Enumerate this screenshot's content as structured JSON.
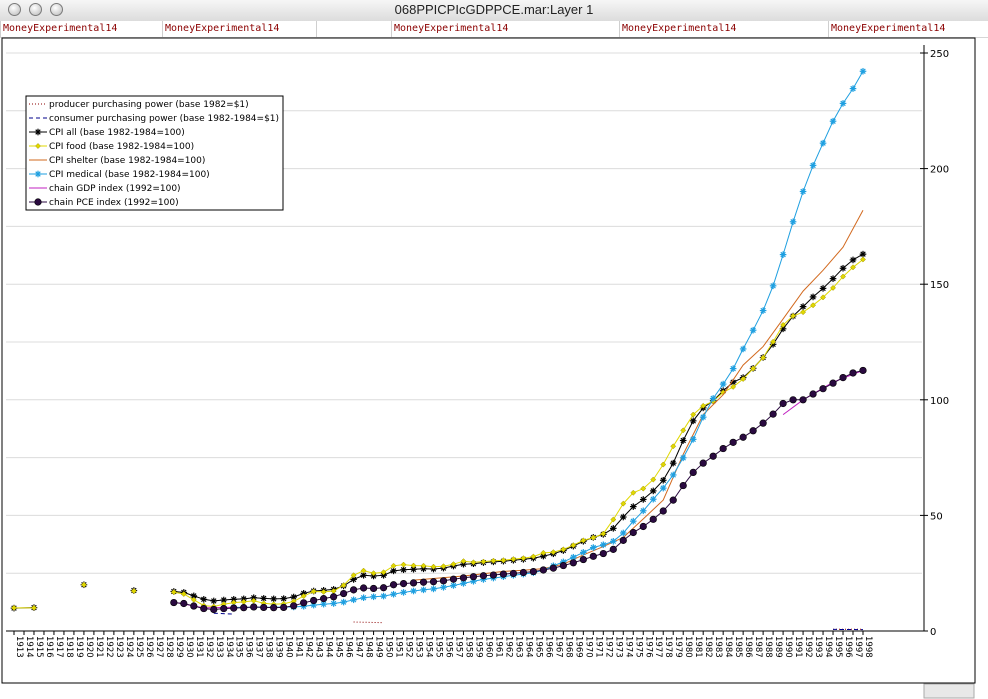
{
  "window": {
    "title": "068PPICPIcGDPPCE.mar:Layer 1"
  },
  "top_tabs": [
    "MoneyExperimental14",
    "MoneyExperimental14",
    "MoneyExperimental14",
    "MoneyExperimental14",
    "MoneyExperimental14"
  ],
  "chart_data": {
    "type": "line",
    "title": "",
    "xlabel": "",
    "ylabel": "",
    "ylim": [
      0,
      250
    ],
    "yticks": [
      0,
      50,
      100,
      150,
      200,
      250
    ],
    "x_range": [
      1913,
      1998
    ],
    "grid": "horizontal",
    "legend_position": "top-left",
    "series": [
      {
        "name": "producer purchasing power (base 1982=$1)",
        "color": "#8b0000",
        "style": "dotted",
        "x": [
          1947,
          1950,
          1955,
          1960,
          1965,
          1970,
          1975,
          1980,
          1985,
          1990,
          1995,
          1998
        ],
        "values": [
          3.9,
          3.6,
          3.4,
          3.1,
          3.0,
          2.7,
          2.0,
          1.4,
          1.0,
          0.9,
          0.8,
          0.8
        ]
      },
      {
        "name": "consumer purchasing power (base 1982-1984=$1)",
        "color": "#00008b",
        "style": "dashed",
        "x": [
          1929,
          1933,
          1935,
          1940,
          1945,
          1950,
          1955,
          1960,
          1965,
          1970,
          1975,
          1980,
          1985,
          1990,
          1995,
          1998
        ],
        "values": [
          5.8,
          7.7,
          7.3,
          7.2,
          5.6,
          4.2,
          3.7,
          3.4,
          3.2,
          2.6,
          1.9,
          1.2,
          0.9,
          0.8,
          0.7,
          0.6
        ]
      },
      {
        "name": "CPI all (base 1982-1984=100)",
        "color": "#000000",
        "marker": "asterisk",
        "x": [
          1913,
          1915,
          1920,
          1925,
          1929,
          1930,
          1931,
          1932,
          1933,
          1934,
          1935,
          1936,
          1937,
          1938,
          1939,
          1940,
          1941,
          1942,
          1943,
          1944,
          1945,
          1946,
          1947,
          1948,
          1949,
          1950,
          1951,
          1952,
          1953,
          1954,
          1955,
          1956,
          1957,
          1958,
          1959,
          1960,
          1961,
          1962,
          1963,
          1964,
          1965,
          1966,
          1967,
          1968,
          1969,
          1970,
          1971,
          1972,
          1973,
          1974,
          1975,
          1976,
          1977,
          1978,
          1979,
          1980,
          1981,
          1982,
          1983,
          1984,
          1985,
          1986,
          1987,
          1988,
          1989,
          1990,
          1991,
          1992,
          1993,
          1994,
          1995,
          1996,
          1997,
          1998
        ],
        "values": [
          9.9,
          10.1,
          20.0,
          17.5,
          17.1,
          16.7,
          15.2,
          13.7,
          13.0,
          13.4,
          13.7,
          13.9,
          14.4,
          14.1,
          13.9,
          14.0,
          14.7,
          16.3,
          17.3,
          17.6,
          18.0,
          19.5,
          22.3,
          24.1,
          23.8,
          24.1,
          26.0,
          26.5,
          26.7,
          26.9,
          26.8,
          27.2,
          28.1,
          28.9,
          29.1,
          29.6,
          29.9,
          30.2,
          30.6,
          31.0,
          31.5,
          32.4,
          33.4,
          34.8,
          36.7,
          38.8,
          40.5,
          41.8,
          44.4,
          49.3,
          53.8,
          56.9,
          60.6,
          65.2,
          72.6,
          82.4,
          90.9,
          96.5,
          99.6,
          103.9,
          107.6,
          109.6,
          113.6,
          118.3,
          124.0,
          130.7,
          136.2,
          140.3,
          144.5,
          148.2,
          152.4,
          156.9,
          160.5,
          163.0
        ]
      },
      {
        "name": "CPI food (base 1982-1984=100)",
        "color": "#e0d800",
        "marker": "diamond",
        "x": [
          1913,
          1915,
          1920,
          1925,
          1929,
          1930,
          1931,
          1932,
          1933,
          1934,
          1935,
          1936,
          1937,
          1938,
          1939,
          1940,
          1941,
          1942,
          1943,
          1944,
          1945,
          1946,
          1947,
          1948,
          1949,
          1950,
          1951,
          1952,
          1953,
          1954,
          1955,
          1956,
          1957,
          1958,
          1959,
          1960,
          1961,
          1962,
          1963,
          1964,
          1965,
          1966,
          1967,
          1968,
          1969,
          1970,
          1971,
          1972,
          1973,
          1974,
          1975,
          1976,
          1977,
          1978,
          1979,
          1980,
          1981,
          1982,
          1983,
          1984,
          1985,
          1986,
          1987,
          1988,
          1989,
          1990,
          1991,
          1992,
          1993,
          1994,
          1995,
          1996,
          1997,
          1998
        ],
        "values": [
          10.0,
          10.0,
          20.0,
          17.3,
          16.8,
          16.0,
          13.5,
          11.0,
          10.6,
          11.6,
          12.3,
          12.6,
          13.1,
          12.0,
          11.6,
          11.8,
          12.8,
          15.1,
          17.1,
          16.9,
          17.3,
          19.8,
          24.1,
          26.1,
          25.0,
          25.4,
          28.2,
          28.7,
          28.3,
          28.2,
          27.8,
          28.0,
          28.9,
          30.2,
          29.7,
          30.0,
          30.4,
          30.6,
          31.1,
          31.5,
          32.2,
          33.8,
          34.1,
          35.3,
          37.1,
          39.2,
          40.4,
          42.1,
          48.2,
          55.1,
          59.8,
          61.6,
          65.5,
          72.0,
          79.9,
          86.8,
          93.6,
          97.4,
          99.4,
          103.2,
          105.6,
          109.0,
          113.5,
          118.2,
          125.1,
          132.4,
          136.3,
          137.9,
          140.9,
          144.3,
          148.4,
          153.3,
          157.3,
          160.7
        ]
      },
      {
        "name": "CPI shelter (base 1982-1984=100)",
        "color": "#d2691e",
        "style": "solid",
        "x": [
          1953,
          1955,
          1958,
          1960,
          1962,
          1964,
          1966,
          1968,
          1970,
          1972,
          1974,
          1976,
          1978,
          1980,
          1982,
          1984,
          1986,
          1988,
          1990,
          1992,
          1994,
          1996,
          1998
        ],
        "values": [
          22.0,
          22.7,
          23.8,
          24.8,
          25.8,
          26.3,
          27.0,
          28.9,
          32.9,
          36.5,
          40.5,
          48.5,
          56.6,
          76.4,
          93.6,
          102.2,
          115.0,
          123.0,
          135.0,
          147.0,
          156.0,
          166.0,
          182.0
        ]
      },
      {
        "name": "CPI medical (base 1982-1984=100)",
        "color": "#1e9fe0",
        "marker": "asterisk",
        "x": [
          1935,
          1936,
          1937,
          1938,
          1939,
          1940,
          1941,
          1942,
          1943,
          1944,
          1945,
          1946,
          1947,
          1948,
          1949,
          1950,
          1951,
          1952,
          1953,
          1954,
          1955,
          1956,
          1957,
          1958,
          1959,
          1960,
          1961,
          1962,
          1963,
          1964,
          1965,
          1966,
          1967,
          1968,
          1969,
          1970,
          1971,
          1972,
          1973,
          1974,
          1975,
          1976,
          1977,
          1978,
          1979,
          1980,
          1981,
          1982,
          1983,
          1984,
          1985,
          1986,
          1987,
          1988,
          1989,
          1990,
          1991,
          1992,
          1993,
          1994,
          1995,
          1996,
          1997,
          1998
        ],
        "values": [
          10.2,
          10.2,
          10.3,
          10.3,
          10.3,
          10.4,
          10.4,
          10.7,
          11.2,
          11.6,
          11.9,
          12.5,
          13.5,
          14.4,
          14.8,
          15.1,
          15.9,
          16.7,
          17.3,
          17.8,
          18.2,
          18.9,
          19.7,
          20.6,
          21.5,
          22.3,
          22.9,
          23.5,
          24.1,
          24.6,
          25.2,
          26.3,
          28.2,
          29.9,
          31.9,
          34.0,
          36.1,
          37.3,
          38.8,
          42.4,
          47.5,
          52.0,
          57.0,
          61.8,
          67.5,
          74.9,
          82.9,
          92.5,
          100.6,
          106.8,
          113.5,
          122.0,
          130.1,
          138.6,
          149.3,
          162.8,
          177.0,
          190.1,
          201.4,
          211.0,
          220.5,
          228.2,
          234.6,
          242.1
        ]
      },
      {
        "name": "chain GDP index (1992=100)",
        "color": "#c020c0",
        "style": "solid",
        "x": [
          1929,
          1932,
          1935,
          1940,
          1945,
          1950,
          1955,
          1960,
          1965,
          1970,
          1975,
          1980,
          1985,
          1990,
          1992,
          1995,
          1998
        ],
        "values": [
          12.5,
          10.0,
          10.3,
          11.0,
          16.5,
          20.8,
          23.5,
          26.5,
          28.4,
          35.0,
          49.2,
          67.5,
          80.5,
          93.6,
          100.0,
          107.6,
          112.7
        ]
      },
      {
        "name": "chain PCE index (1992=100)",
        "color": "#2a0a40",
        "marker": "circle",
        "x": [
          1929,
          1930,
          1931,
          1932,
          1933,
          1934,
          1935,
          1936,
          1937,
          1938,
          1939,
          1940,
          1941,
          1942,
          1943,
          1944,
          1945,
          1946,
          1947,
          1948,
          1949,
          1950,
          1951,
          1952,
          1953,
          1954,
          1955,
          1956,
          1957,
          1958,
          1959,
          1960,
          1961,
          1962,
          1963,
          1964,
          1965,
          1966,
          1967,
          1968,
          1969,
          1970,
          1971,
          1972,
          1973,
          1974,
          1975,
          1976,
          1977,
          1978,
          1979,
          1980,
          1981,
          1982,
          1983,
          1984,
          1985,
          1986,
          1987,
          1988,
          1989,
          1990,
          1991,
          1992,
          1993,
          1994,
          1995,
          1996,
          1997,
          1998
        ],
        "values": [
          12.3,
          11.9,
          10.8,
          9.7,
          9.3,
          9.7,
          9.9,
          10.1,
          10.4,
          10.2,
          10.1,
          10.2,
          10.9,
          12.2,
          13.2,
          14.0,
          14.8,
          16.2,
          17.8,
          18.6,
          18.4,
          18.7,
          20.0,
          20.5,
          20.8,
          21.1,
          21.3,
          21.7,
          22.4,
          23.0,
          23.5,
          23.9,
          24.2,
          24.6,
          24.9,
          25.3,
          25.7,
          26.4,
          27.2,
          28.3,
          29.5,
          30.9,
          32.3,
          33.5,
          35.3,
          39.2,
          42.6,
          45.2,
          48.3,
          51.9,
          56.6,
          62.9,
          68.6,
          72.6,
          75.6,
          78.9,
          81.6,
          83.8,
          86.6,
          89.9,
          93.8,
          98.4,
          100.0,
          100.0,
          102.5,
          104.8,
          107.2,
          109.6,
          111.6,
          112.7
        ]
      }
    ],
    "x_tick_labels": [
      "1913",
      "1914",
      "1915",
      "1916",
      "1917",
      "1918",
      "1919",
      "1920",
      "1921",
      "1922",
      "1923",
      "1924",
      "1925",
      "1926",
      "1927",
      "1928",
      "1929",
      "1930",
      "1931",
      "1932",
      "1933",
      "1934",
      "1935",
      "1936",
      "1937",
      "1938",
      "1939",
      "1940",
      "1941",
      "1942",
      "1943",
      "1944",
      "1945",
      "1946",
      "1947",
      "1948",
      "1949",
      "1950",
      "1951",
      "1952",
      "1953",
      "1954",
      "1955",
      "1956",
      "1957",
      "1958",
      "1959",
      "1960",
      "1961",
      "1962",
      "1963",
      "1964",
      "1965",
      "1966",
      "1967",
      "1968",
      "1969",
      "1970",
      "1971",
      "1972",
      "1973",
      "1974",
      "1975",
      "1976",
      "1977",
      "1978",
      "1979",
      "1980",
      "1981",
      "1982",
      "1983",
      "1984",
      "1985",
      "1986",
      "1987",
      "1988",
      "1989",
      "1990",
      "1991",
      "1992",
      "1993",
      "1994",
      "1995",
      "1996",
      "1997",
      "1998"
    ]
  }
}
